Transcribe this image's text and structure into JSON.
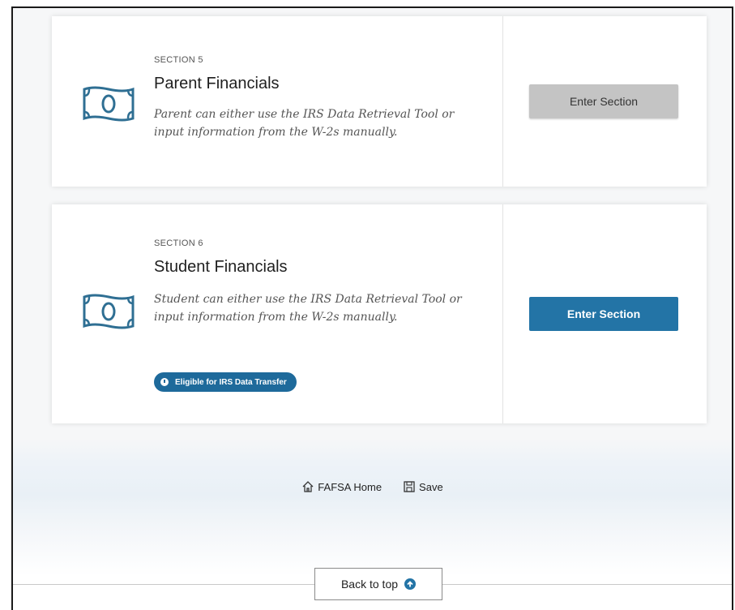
{
  "sections": [
    {
      "number_label": "SECTION 5",
      "title": "Parent Financials",
      "description": "Parent can either use the IRS Data Retrieval Tool or input information from the W-2s manually.",
      "button_label": "Enter Section",
      "button_state": "disabled",
      "icon": "money-icon"
    },
    {
      "number_label": "SECTION 6",
      "title": "Student Financials",
      "description": "Student can either use the IRS Data Retrieval Tool or input information from the W-2s manually.",
      "button_label": "Enter Section",
      "button_state": "enabled",
      "badge_label": "Eligible for IRS Data Transfer",
      "icon": "money-icon"
    }
  ],
  "footer": {
    "home_label": "FAFSA Home",
    "save_label": "Save"
  },
  "back_to_top_label": "Back to top",
  "colors": {
    "accent": "#2374a6",
    "badge": "#1e6a9b",
    "disabled_button": "#c4c4c4",
    "icon_stroke": "#2f6f93"
  }
}
